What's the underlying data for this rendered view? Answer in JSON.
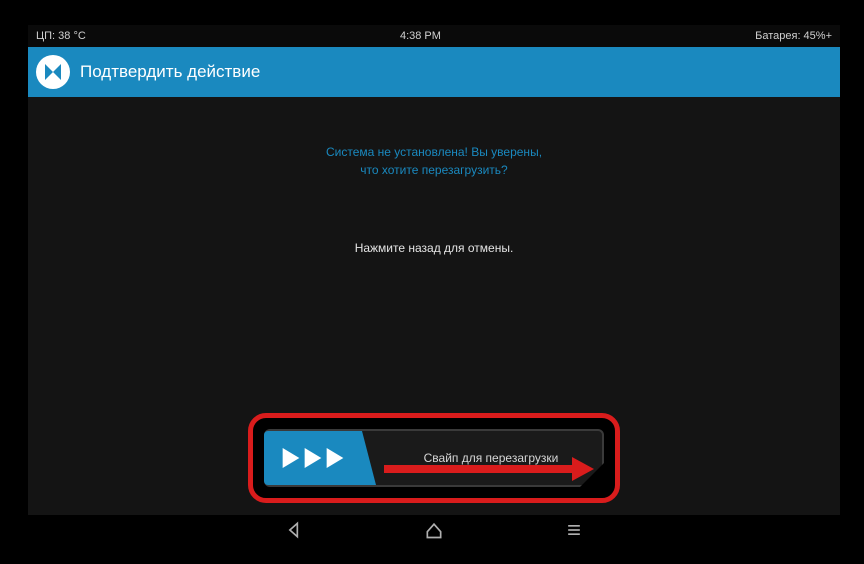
{
  "status": {
    "cpu_temp": "ЦП: 38 °C",
    "time": "4:38 PM",
    "battery": "Батарея: 45%+"
  },
  "header": {
    "title": "Подтвердить действие"
  },
  "warning": {
    "line1": "Система не установлена! Вы уверены,",
    "line2": "что хотите перезагрузить?"
  },
  "cancel_hint": "Нажмите назад для отмены.",
  "slider": {
    "label": "Свайп для перезагрузки"
  },
  "icons": {
    "logo": "twrp-logo-icon",
    "handle_arrow": "play-icon",
    "nav_back": "back-icon",
    "nav_home": "home-icon",
    "nav_menu": "menu-icon"
  },
  "colors": {
    "accent": "#1a89bf",
    "highlight": "#d91c1c",
    "bg": "#141414"
  }
}
